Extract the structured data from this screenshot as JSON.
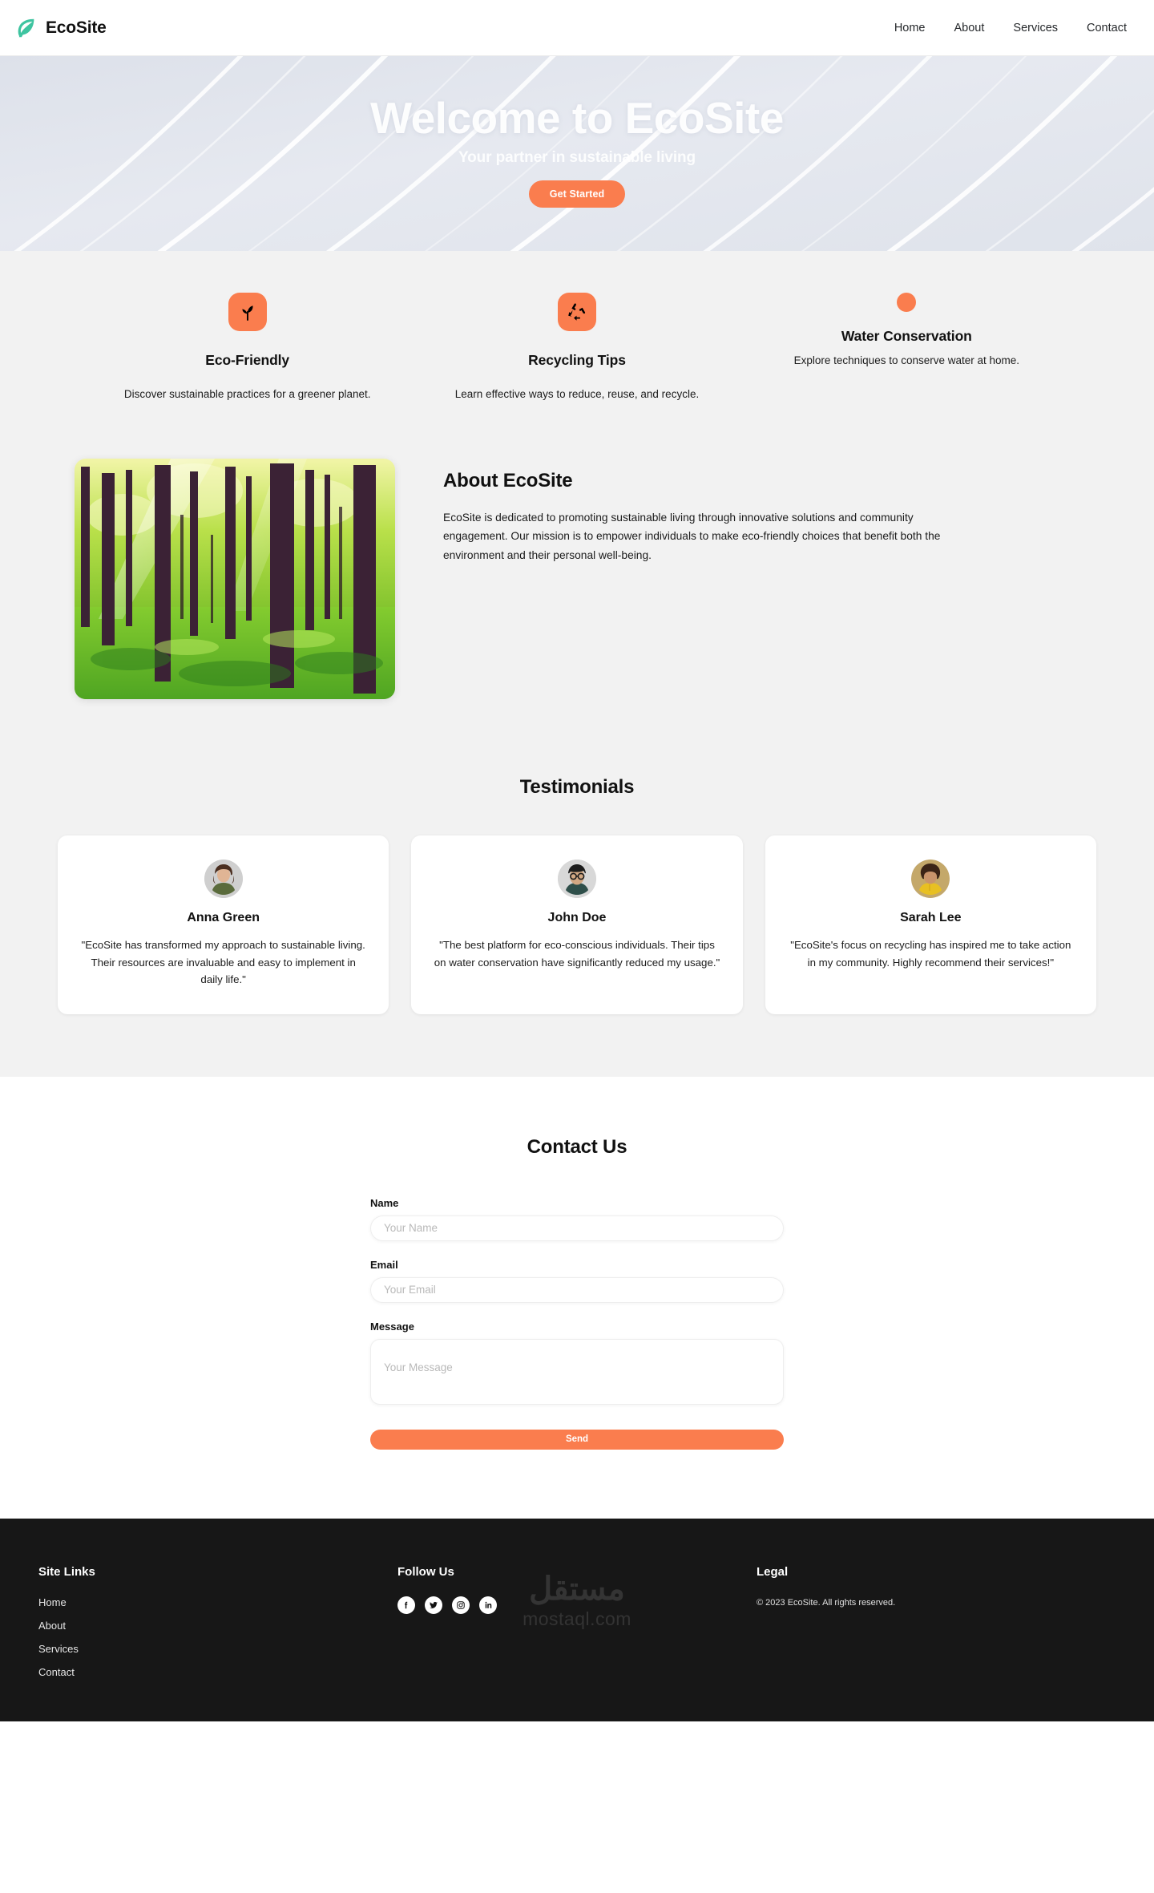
{
  "brand": {
    "name": "EcoSite",
    "logo_icon": "leaf-icon",
    "logo_color": "#3ec4a0"
  },
  "nav": {
    "links": [
      {
        "label": "Home"
      },
      {
        "label": "About"
      },
      {
        "label": "Services"
      },
      {
        "label": "Contact"
      }
    ]
  },
  "hero": {
    "title": "Welcome to EcoSite",
    "subtitle": "Your partner in sustainable living",
    "cta_label": "Get Started",
    "cta_color": "#fa7d4e",
    "background": "#e2e6ee"
  },
  "features": {
    "items": [
      {
        "icon": "seedling-icon",
        "title": "Eco-Friendly",
        "desc": "Discover sustainable practices for a greener planet."
      },
      {
        "icon": "recycle-icon",
        "title": "Recycling Tips",
        "desc": "Learn effective ways to reduce, reuse, and recycle."
      },
      {
        "icon": "water-drop-icon",
        "title": "Water Conservation",
        "desc": "Explore techniques to conserve water at home."
      }
    ]
  },
  "about": {
    "image_alt": "forest-photo",
    "title": "About EcoSite",
    "body": "EcoSite is dedicated to promoting sustainable living through innovative solutions and community engagement. Our mission is to empower individuals to make eco-friendly choices that benefit both the environment and their personal well-being."
  },
  "testimonials": {
    "title": "Testimonials",
    "items": [
      {
        "name": "Anna Green",
        "quote": "\"EcoSite has transformed my approach to sustainable living. Their resources are invaluable and easy to implement in daily life.\""
      },
      {
        "name": "John Doe",
        "quote": "\"The best platform for eco-conscious individuals. Their tips on water conservation have significantly reduced my usage.\""
      },
      {
        "name": "Sarah Lee",
        "quote": "\"EcoSite's focus on recycling has inspired me to take action in my community. Highly recommend their services!\""
      }
    ]
  },
  "contact": {
    "title": "Contact Us",
    "name_label": "Name",
    "name_placeholder": "Your Name",
    "name_value": "",
    "email_label": "Email",
    "email_placeholder": "Your Email",
    "email_value": "",
    "message_label": "Message",
    "message_placeholder": "Your Message",
    "message_value": "",
    "submit_label": "Send",
    "submit_color": "#fa7d4e"
  },
  "footer": {
    "site_links_title": "Site Links",
    "site_links": [
      {
        "label": "Home"
      },
      {
        "label": "About"
      },
      {
        "label": "Services"
      },
      {
        "label": "Contact"
      }
    ],
    "follow_title": "Follow Us",
    "socials": [
      {
        "icon": "facebook-icon"
      },
      {
        "icon": "twitter-icon"
      },
      {
        "icon": "instagram-icon"
      },
      {
        "icon": "linkedin-icon"
      }
    ],
    "legal_title": "Legal",
    "copyright": "© 2023 EcoSite. All rights reserved.",
    "watermark_arabic": "مستقل",
    "watermark_latin": "mostaql.com",
    "background": "#171717"
  }
}
